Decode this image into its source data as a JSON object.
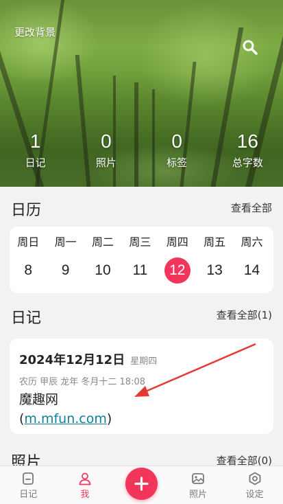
{
  "header": {
    "change_bg_label": "更改背景",
    "search_icon": "search-icon"
  },
  "stats": [
    {
      "value": "1",
      "label": "日记"
    },
    {
      "value": "0",
      "label": "照片"
    },
    {
      "value": "0",
      "label": "标签"
    },
    {
      "value": "16",
      "label": "总字数"
    }
  ],
  "calendar": {
    "title": "日历",
    "see_all": "查看全部",
    "days": [
      {
        "name": "周日",
        "num": "8"
      },
      {
        "name": "周一",
        "num": "9"
      },
      {
        "name": "周二",
        "num": "10"
      },
      {
        "name": "周三",
        "num": "11"
      },
      {
        "name": "周四",
        "num": "12"
      },
      {
        "name": "周五",
        "num": "13"
      },
      {
        "name": "周六",
        "num": "14"
      }
    ],
    "today_num": "12"
  },
  "diary": {
    "title": "日记",
    "see_all": "查看全部(1)",
    "entry": {
      "date": "2024年12月12日",
      "weekday": "星期四",
      "lunar": "农历  甲辰 龙年 冬月十二  18:08",
      "text_line1": "魔趣网",
      "link_open": "(",
      "link": "m.mfun.com",
      "link_close": ")"
    }
  },
  "photos": {
    "title": "照片",
    "see_all": "查看全部(0)"
  },
  "tabbar": {
    "tabs": [
      {
        "label": "日记",
        "icon": "diary-icon"
      },
      {
        "label": "我",
        "icon": "person-icon"
      },
      {
        "label": "",
        "icon": "plus-icon"
      },
      {
        "label": "照片",
        "icon": "photo-icon"
      },
      {
        "label": "设定",
        "icon": "settings-icon"
      }
    ]
  },
  "colors": {
    "accent": "#f2365b",
    "link": "#0f7f9a",
    "annotation_arrow": "#e53935"
  }
}
